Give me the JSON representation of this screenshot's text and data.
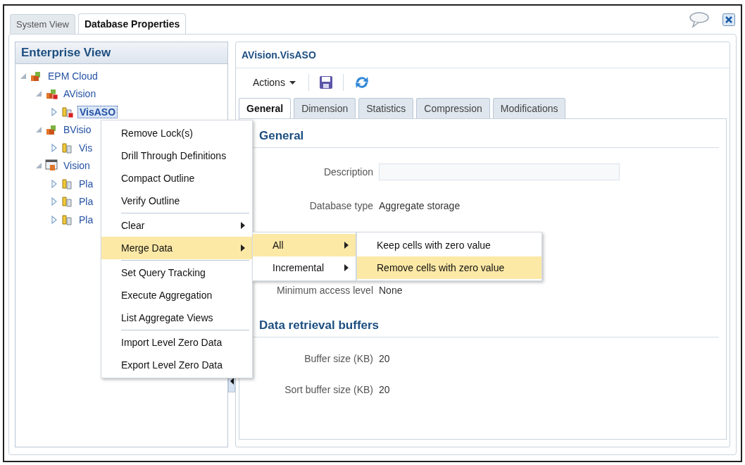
{
  "tabs": [
    {
      "label": "System View",
      "selected": false
    },
    {
      "label": "Database Properties",
      "selected": true
    }
  ],
  "enterprise_view": {
    "title": "Enterprise View",
    "tree": [
      {
        "label": "EPM Cloud",
        "kind": "server",
        "expanded": true,
        "selected": false,
        "children": [
          {
            "label": "AVision",
            "kind": "server-locked",
            "expanded": true,
            "selected": false,
            "children": [
              {
                "label": "VisASO",
                "kind": "db-locked",
                "expanded": false,
                "selected": true
              }
            ]
          },
          {
            "label": "BVisio",
            "kind": "server",
            "expanded": true,
            "selected": false,
            "children": [
              {
                "label": "Vis",
                "kind": "db",
                "expanded": false,
                "selected": false
              }
            ]
          },
          {
            "label": "Vision",
            "kind": "window-server",
            "expanded": true,
            "selected": false,
            "children": [
              {
                "label": "Pla",
                "kind": "db",
                "expanded": false,
                "selected": false
              },
              {
                "label": "Pla",
                "kind": "db",
                "expanded": false,
                "selected": false
              },
              {
                "label": "Pla",
                "kind": "db",
                "expanded": false,
                "selected": false
              }
            ]
          }
        ]
      }
    ]
  },
  "context_menu": {
    "groups": [
      [
        {
          "label": "Remove Lock(s)",
          "submenu": false,
          "selected": false
        },
        {
          "label": "Drill Through Definitions",
          "submenu": false,
          "selected": false
        },
        {
          "label": "Compact Outline",
          "submenu": false,
          "selected": false
        },
        {
          "label": "Verify Outline",
          "submenu": false,
          "selected": false
        }
      ],
      [
        {
          "label": "Clear",
          "submenu": true,
          "selected": false
        },
        {
          "label": "Merge Data",
          "submenu": true,
          "selected": true
        }
      ],
      [
        {
          "label": "Set Query Tracking",
          "submenu": false,
          "selected": false
        },
        {
          "label": "Execute Aggregation",
          "submenu": false,
          "selected": false
        },
        {
          "label": "List Aggregate Views",
          "submenu": false,
          "selected": false
        }
      ],
      [
        {
          "label": "Import Level Zero Data",
          "submenu": false,
          "selected": false
        },
        {
          "label": "Export Level Zero Data",
          "submenu": false,
          "selected": false
        }
      ]
    ]
  },
  "merge_submenu": [
    {
      "label": "All",
      "submenu": true,
      "selected": true
    },
    {
      "label": "Incremental",
      "submenu": true,
      "selected": false
    }
  ],
  "all_submenu": [
    {
      "label": "Keep cells with zero value",
      "submenu": false,
      "selected": false
    },
    {
      "label": "Remove cells with zero value",
      "submenu": false,
      "selected": true
    }
  ],
  "properties": {
    "title": "AVision.VisASO",
    "actions_label": "Actions",
    "tabs": [
      {
        "label": "General",
        "selected": true
      },
      {
        "label": "Dimension",
        "selected": false
      },
      {
        "label": "Statistics",
        "selected": false
      },
      {
        "label": "Compression",
        "selected": false
      },
      {
        "label": "Modifications",
        "selected": false
      }
    ],
    "sections": [
      {
        "title": "General",
        "fields": [
          {
            "label": "Description",
            "kind": "input"
          },
          {
            "label": "Database type",
            "kind": "text",
            "value": "Aggregate storage"
          },
          {
            "label": "Minimum access level",
            "kind": "text",
            "value": "None"
          }
        ]
      },
      {
        "title": "Data retrieval buffers",
        "fields": [
          {
            "label": "Buffer size (KB)",
            "kind": "text",
            "value": "20"
          },
          {
            "label": "Sort buffer size (KB)",
            "kind": "text",
            "value": "20"
          }
        ]
      }
    ]
  }
}
